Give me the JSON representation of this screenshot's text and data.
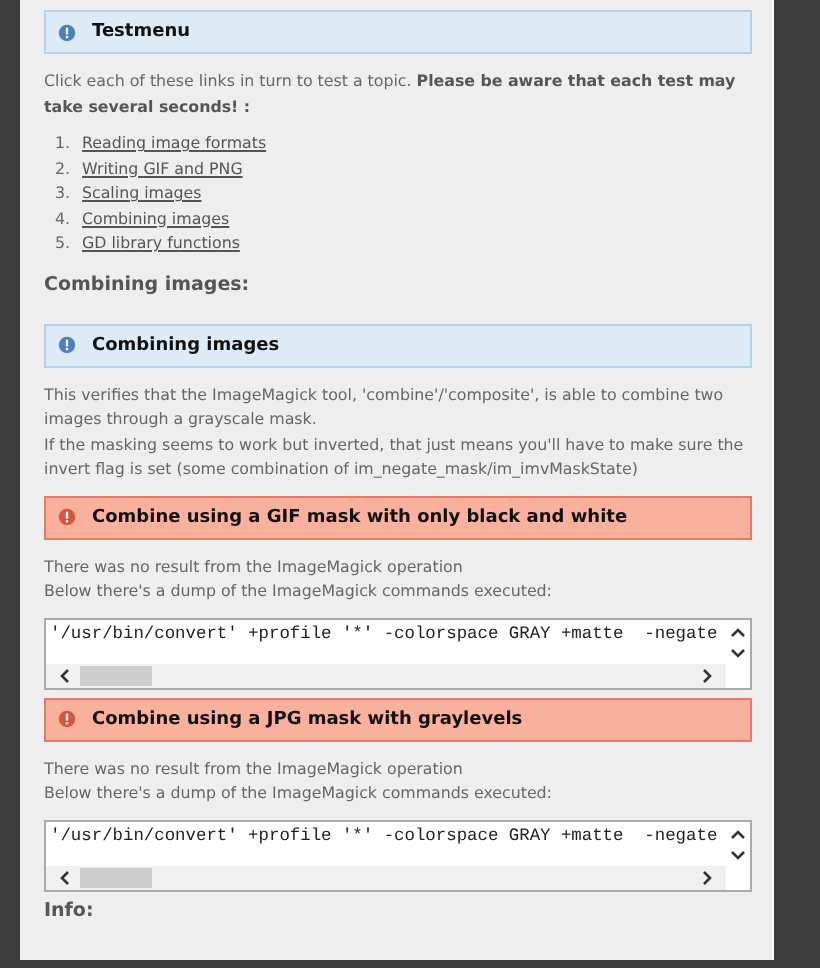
{
  "blocks": [
    {
      "kind": "info",
      "title": "Testmenu"
    },
    {
      "kind": "para",
      "lines": [
        "Click each of these links in turn to test a topic. **Please be aware that each test may take several seconds! :**"
      ]
    },
    {
      "kind": "list",
      "items": [
        {
          "number": "1.",
          "label": "Reading image formats"
        },
        {
          "number": "2.",
          "label": "Writing GIF and PNG"
        },
        {
          "number": "3.",
          "label": "Scaling images"
        },
        {
          "number": "4.",
          "label": "Combining images"
        },
        {
          "number": "5.",
          "label": "GD library functions"
        }
      ]
    },
    {
      "kind": "heading",
      "title": "Combining images:"
    },
    {
      "kind": "info",
      "title": "Combining images"
    },
    {
      "kind": "para",
      "lines": [
        "This verifies that the ImageMagick tool, 'combine'/'composite', is able to combine two images through a grayscale mask.",
        "If the masking seems to work but inverted, that just means you'll have to make sure the invert flag is set (some combination of im_negate_mask/im_imvMaskState)"
      ]
    },
    {
      "kind": "error",
      "title": "Combine using a GIF mask with only black and white"
    },
    {
      "kind": "para",
      "lines": [
        "There was no result from the ImageMagick operation",
        "Below there's a dump of the ImageMagick commands executed:"
      ]
    },
    {
      "kind": "code",
      "text": "'/usr/bin/convert' +profile '*' -colorspace GRAY +matte  -negate"
    },
    {
      "kind": "error",
      "title": "Combine using a JPG mask with graylevels"
    },
    {
      "kind": "para",
      "lines": [
        "There was no result from the ImageMagick operation",
        "Below there's a dump of the ImageMagick commands executed:"
      ]
    },
    {
      "kind": "code",
      "text": "'/usr/bin/convert' +profile '*' -colorspace GRAY +matte  -negate"
    },
    {
      "kind": "heading",
      "title": "Info:"
    }
  ]
}
